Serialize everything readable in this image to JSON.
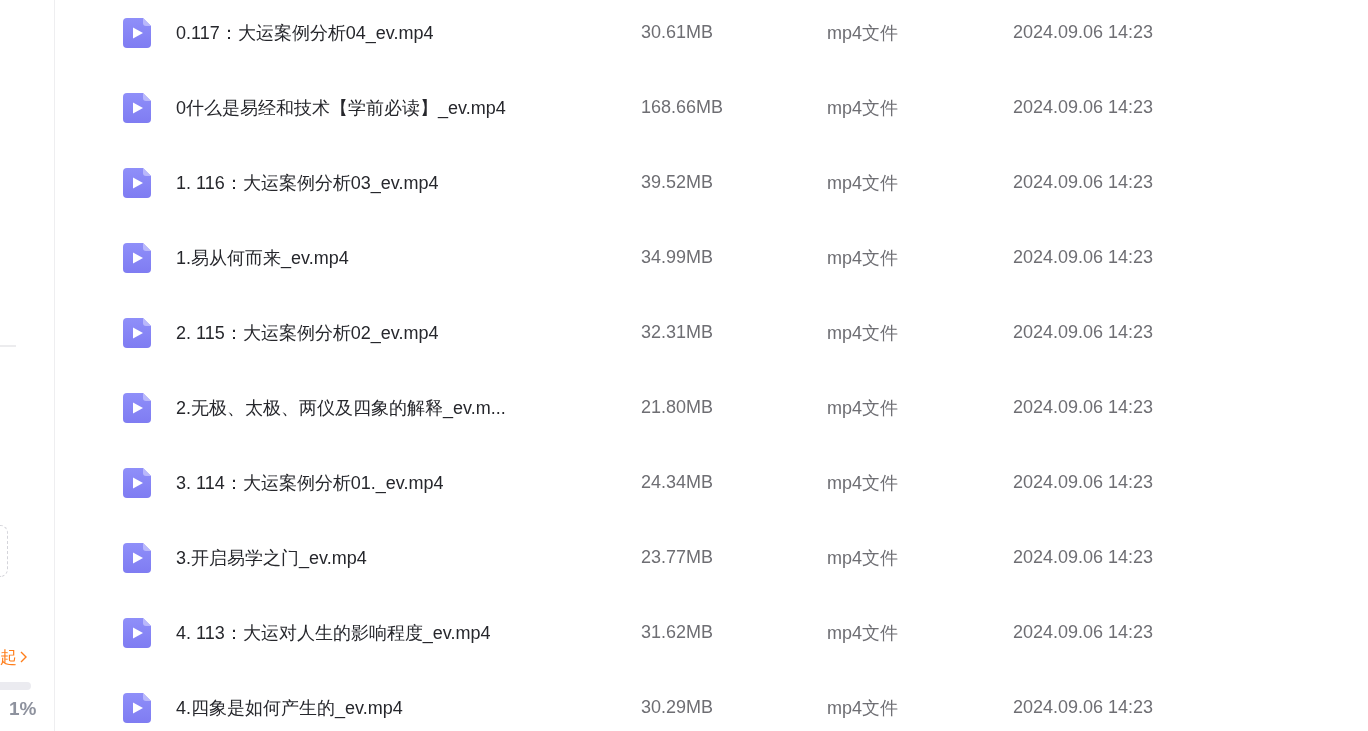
{
  "sidebar": {
    "link": {
      "text": "起"
    },
    "storage": {
      "percent": "1%"
    }
  },
  "files": [
    {
      "name": "0.117：大运案例分析04_ev.mp4",
      "size": "30.61MB",
      "type": "mp4文件",
      "modified": "2024.09.06 14:23"
    },
    {
      "name": "0什么是易经和技术【学前必读】_ev.mp4",
      "size": "168.66MB",
      "type": "mp4文件",
      "modified": "2024.09.06 14:23"
    },
    {
      "name": "1. 116：大运案例分析03_ev.mp4",
      "size": "39.52MB",
      "type": "mp4文件",
      "modified": "2024.09.06 14:23"
    },
    {
      "name": "1.易从何而来_ev.mp4",
      "size": "34.99MB",
      "type": "mp4文件",
      "modified": "2024.09.06 14:23"
    },
    {
      "name": "2. 115：大运案例分析02_ev.mp4",
      "size": "32.31MB",
      "type": "mp4文件",
      "modified": "2024.09.06 14:23"
    },
    {
      "name": "2.无极、太极、两仪及四象的解释_ev.m...",
      "size": "21.80MB",
      "type": "mp4文件",
      "modified": "2024.09.06 14:23"
    },
    {
      "name": "3. 114：大运案例分析01._ev.mp4",
      "size": "24.34MB",
      "type": "mp4文件",
      "modified": "2024.09.06 14:23"
    },
    {
      "name": "3.开启易学之门_ev.mp4",
      "size": "23.77MB",
      "type": "mp4文件",
      "modified": "2024.09.06 14:23"
    },
    {
      "name": "4. 113：大运对人生的影响程度_ev.mp4",
      "size": "31.62MB",
      "type": "mp4文件",
      "modified": "2024.09.06 14:23"
    },
    {
      "name": "4.四象是如何产生的_ev.mp4",
      "size": "30.29MB",
      "type": "mp4文件",
      "modified": "2024.09.06 14:23"
    }
  ]
}
